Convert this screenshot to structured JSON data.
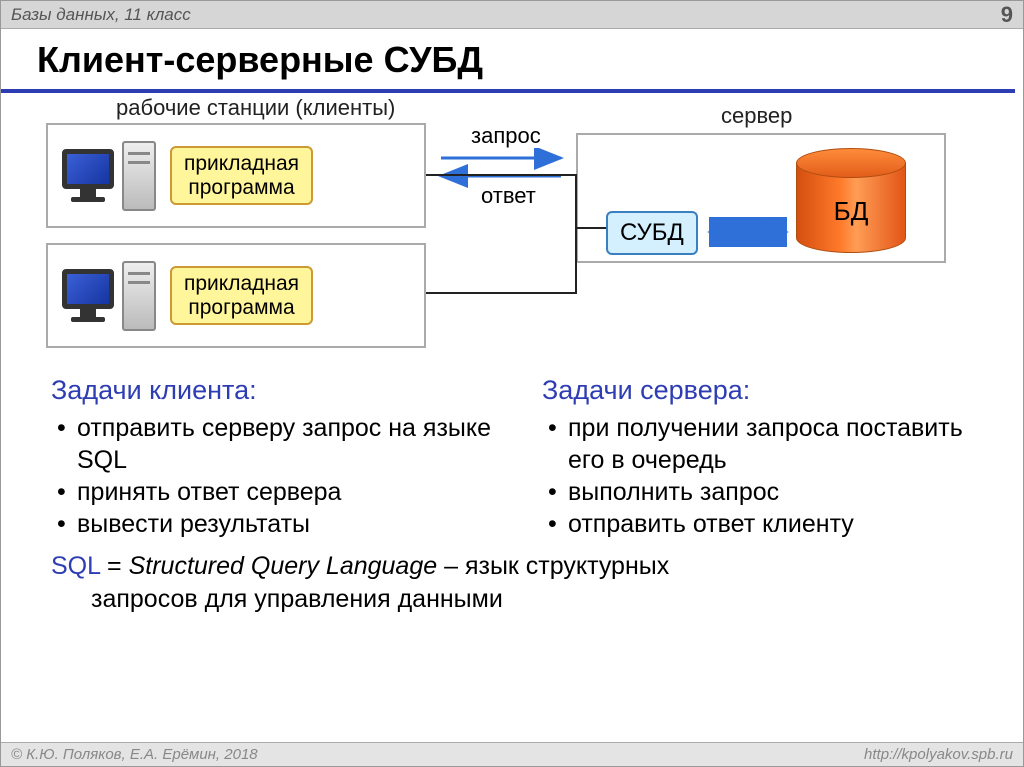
{
  "header": {
    "breadcrumb": "Базы данных, 11 класс",
    "page_number": "9"
  },
  "title": "Клиент-серверные СУБД",
  "diagram": {
    "clients_label": "рабочие станции (клиенты)",
    "server_label": "сервер",
    "app_box_line1": "прикладная",
    "app_box_line2": "программа",
    "request_label": "запрос",
    "response_label": "ответ",
    "dbms_label": "СУБД",
    "db_label": "БД"
  },
  "tasks": {
    "client_title": "Задачи клиента",
    "client_items": [
      "отправить серверу запрос на языке SQL",
      "принять ответ сервера",
      "вывести результаты"
    ],
    "server_title": "Задачи сервера",
    "server_items": [
      "при получении запроса поставить его в очередь",
      "выполнить запрос",
      "отправить ответ клиенту"
    ]
  },
  "sql": {
    "kw": "SQL",
    "eq": " = ",
    "english": "Structured Query Language",
    "dash": " – язык структурных",
    "line2": "запросов для управления данными"
  },
  "footer": {
    "left": "© К.Ю. Поляков, Е.А. Ерёмин, 2018",
    "right": "http://kpolyakov.spb.ru"
  }
}
